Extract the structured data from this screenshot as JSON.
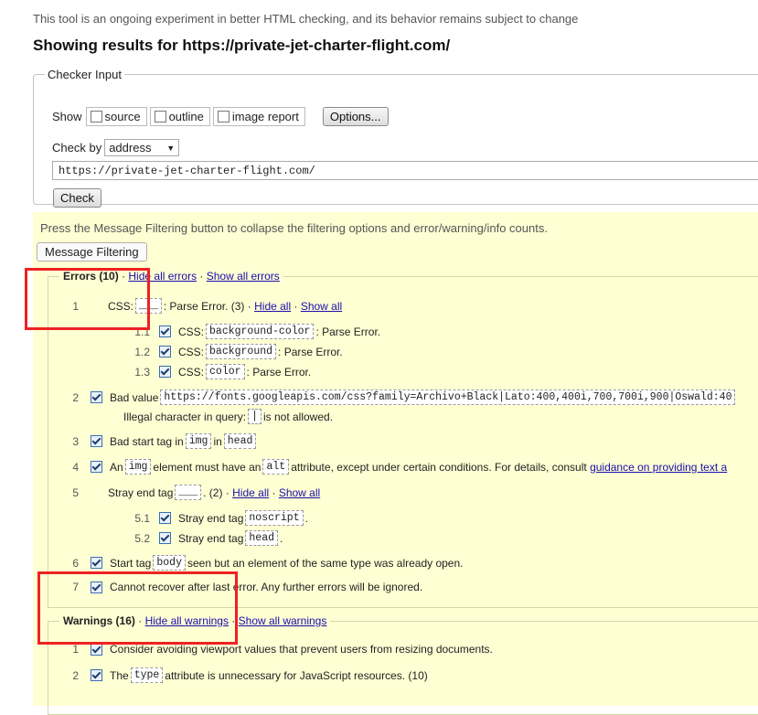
{
  "intro": "This tool is an ongoing experiment in better HTML checking, and its behavior remains subject to change",
  "title": "Showing results for https://private-jet-charter-flight.com/",
  "checker": {
    "legend": "Checker Input",
    "show_label": "Show",
    "options": [
      "source",
      "outline",
      "image report"
    ],
    "options_button": "Options...",
    "check_by_label": "Check by",
    "check_by_value": "address",
    "url": "https://private-jet-charter-flight.com/",
    "check_button": "Check"
  },
  "filter": {
    "note": "Press the Message Filtering button to collapse the filtering options and error/warning/info counts.",
    "button": "Message Filtering"
  },
  "errors": {
    "legend": "Errors (10)",
    "hide_all": "Hide all errors",
    "show_all": "Show all errors",
    "hide_all_short": "Hide all",
    "show_all_short": "Show all",
    "m1": {
      "n": "1",
      "pre": "CSS:",
      "code": "___",
      "post": ": Parse Error. (3) ·"
    },
    "m1_1": {
      "n": "1.1",
      "pre": "CSS:",
      "code": "background-color",
      "post": ": Parse Error."
    },
    "m1_2": {
      "n": "1.2",
      "pre": "CSS:",
      "code": "background",
      "post": ": Parse Error."
    },
    "m1_3": {
      "n": "1.3",
      "pre": "CSS:",
      "code": "color",
      "post": ": Parse Error."
    },
    "m2": {
      "n": "2",
      "pre": "Bad value",
      "code": "https://fonts.googleapis.com/css?family=Archivo+Black|Lato:400,400i,700,700i,900|Oswald:40",
      "line2_pre": "Illegal character in query:",
      "line2_code": "|",
      "line2_post": "is not allowed."
    },
    "m3": {
      "n": "3",
      "pre": "Bad start tag in",
      "code": "img",
      "mid": "in",
      "code2": "head"
    },
    "m4": {
      "n": "4",
      "pre": "An",
      "code": "img",
      "mid": "element must have an",
      "code2": "alt",
      "post": "attribute, except under certain conditions. For details, consult",
      "link": "guidance on providing text a"
    },
    "m5": {
      "n": "5",
      "pre": "Stray end tag",
      "code": "___",
      "post": ". (2) ·"
    },
    "m5_1": {
      "n": "5.1",
      "pre": "Stray end tag",
      "code": "noscript",
      "post": "."
    },
    "m5_2": {
      "n": "5.2",
      "pre": "Stray end tag",
      "code": "head",
      "post": "."
    },
    "m6": {
      "n": "6",
      "pre": "Start tag",
      "code": "body",
      "post": "seen but an element of the same type was already open."
    },
    "m7": {
      "n": "7",
      "pre": "Cannot recover after last error. Any further errors will be ignored."
    }
  },
  "warnings": {
    "legend": "Warnings (16)",
    "hide_all": "Hide all warnings",
    "show_all": "Show all warnings",
    "w1": {
      "n": "1",
      "pre": "Consider avoiding viewport values that prevent users from resizing documents."
    },
    "w2": {
      "n": "2",
      "pre": "The",
      "code": "type",
      "post": "attribute is unnecessary for JavaScript resources. (10)"
    }
  }
}
